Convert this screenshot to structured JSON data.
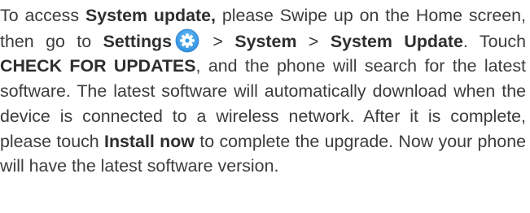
{
  "paragraph": {
    "s1_pre": "To access ",
    "s1_bold": "System update,",
    "s1_post": " please Swipe up on the Home screen, then go to ",
    "settings_label": "Settings",
    "settings_icon": "settings-gear-icon",
    "sep1": " > ",
    "system_label": "System",
    "sep2": " > ",
    "system_update_label": "System Update",
    "s2_pre": ". Touch ",
    "check_label": "CHECK FOR UPDATES",
    "s2_post": ", and the phone will search for the latest software. The latest software will automatically download when the device is connected to a wireless network. After it is complete, please touch ",
    "install_label": "Install now",
    "s3_post": " to complete the upgrade. Now your phone will have the latest software version."
  },
  "colors": {
    "text": "#3c3c3c",
    "icon_ring": "#3b9ee8",
    "icon_inner": "#ffffff"
  }
}
